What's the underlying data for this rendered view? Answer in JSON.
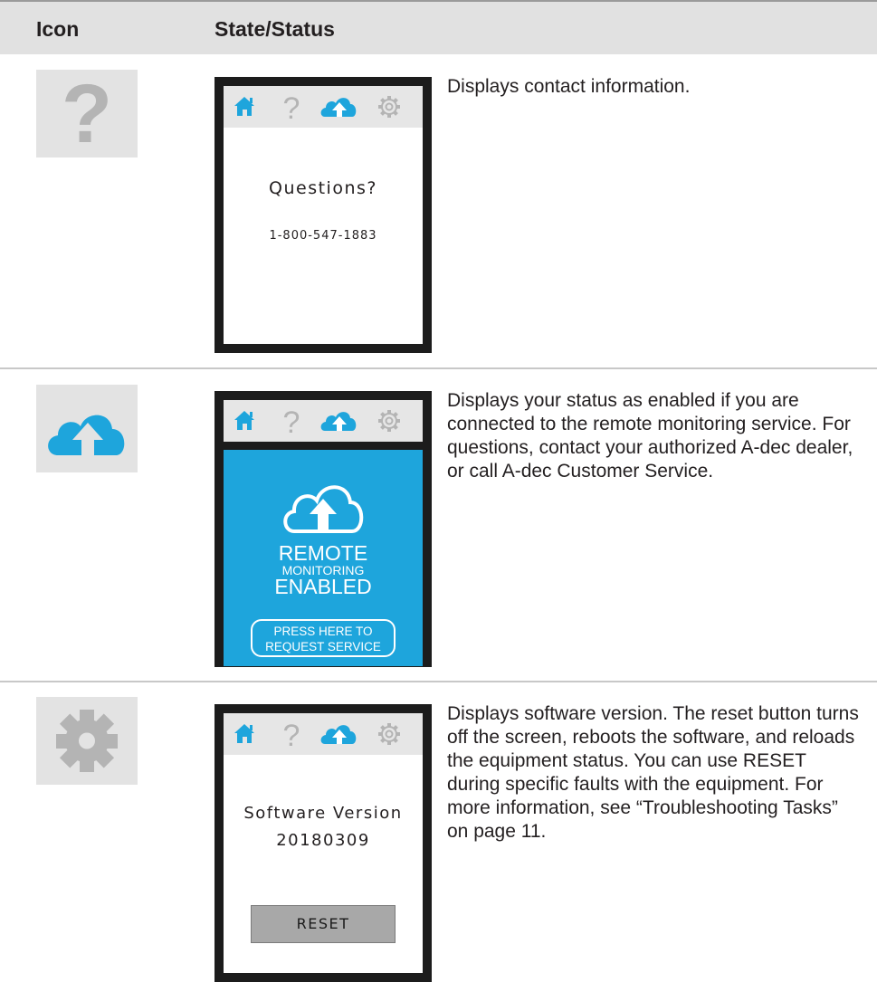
{
  "table": {
    "header": {
      "icon": "Icon",
      "state": "State/Status"
    },
    "rows": [
      {
        "icon": "question-icon",
        "screen": {
          "title": "Questions?",
          "phone": "1-800-547-1883"
        },
        "description": "Displays contact information."
      },
      {
        "icon": "cloud-upload-icon",
        "screen": {
          "line1": "REMOTE",
          "line2": "MONITORING",
          "line3": "ENABLED",
          "button_line1": "PRESS HERE TO",
          "button_line2": "REQUEST SERVICE"
        },
        "description": "Displays your status as enabled if you are connected to the remote monitoring service. For questions, contact your authorized A-dec dealer, or call A-dec Customer Service."
      },
      {
        "icon": "gear-icon",
        "screen": {
          "title": "Software Version",
          "version": "20180309",
          "button": "RESET"
        },
        "description": "Displays software version. The reset button turns off the screen, reboots the software, and reloads the equipment status. You can use RESET during specific faults with the equipment. For more information, see “Troubleshooting Tasks” on page 11."
      }
    ]
  },
  "tabs": [
    "home-icon",
    "question-icon",
    "cloud-upload-icon",
    "gear-icon"
  ],
  "colors": {
    "accent": "#1ea5dc",
    "tile": "#e3e3e3",
    "icon_gray": "#b4b4b4",
    "header": "#e1e1e1"
  }
}
